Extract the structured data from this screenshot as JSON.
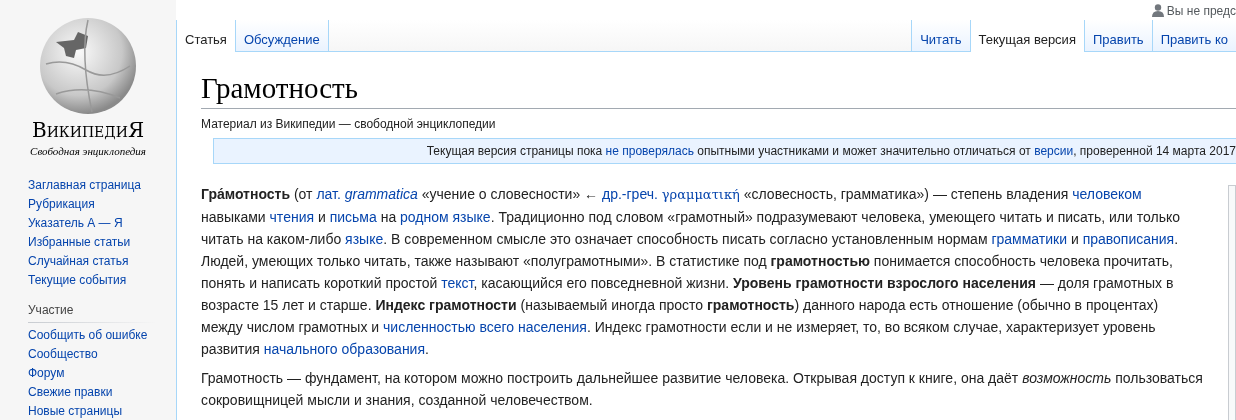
{
  "user_menu": {
    "label": "Вы не предс"
  },
  "logo": {
    "wordmark": "ВикипедиЯ",
    "tagline": "Свободная энциклопедия"
  },
  "sidebar": {
    "items": [
      {
        "label": "Заглавная страница"
      },
      {
        "label": "Рубрикация"
      },
      {
        "label": "Указатель А — Я"
      },
      {
        "label": "Избранные статьи"
      },
      {
        "label": "Случайная статья"
      },
      {
        "label": "Текущие события"
      }
    ],
    "sections": [
      {
        "heading": "Участие",
        "items": [
          {
            "label": "Сообщить об ошибке"
          },
          {
            "label": "Сообщество"
          },
          {
            "label": "Форум"
          },
          {
            "label": "Свежие правки"
          },
          {
            "label": "Новые страницы"
          }
        ]
      }
    ]
  },
  "namespace_tabs": [
    {
      "label": "Статья",
      "selected": true
    },
    {
      "label": "Обсуждение",
      "selected": false
    }
  ],
  "view_tabs": [
    {
      "label": "Читать",
      "selected": false
    },
    {
      "label": "Текущая версия",
      "selected": true
    },
    {
      "label": "Править",
      "selected": false
    },
    {
      "label": "Править ко",
      "selected": false
    }
  ],
  "article": {
    "title": "Грамотность",
    "subtitle": "Материал из Википедии — свободной энциклопедии",
    "notice": [
      {
        "kind": "text",
        "text": "Текущая версия страницы пока "
      },
      {
        "kind": "link",
        "text": "не проверялась"
      },
      {
        "kind": "text",
        "text": " опытными участниками и может значительно отличаться от "
      },
      {
        "kind": "link",
        "text": "версии"
      },
      {
        "kind": "text",
        "text": ", проверенной 14 марта 2017"
      }
    ],
    "paragraphs": [
      [
        {
          "kind": "bold",
          "text": "Гра́мотность"
        },
        {
          "kind": "text",
          "text": " (от "
        },
        {
          "kind": "link",
          "text": "лат.",
          "gap": true
        },
        {
          "kind": "link_italic",
          "text": "grammatica"
        },
        {
          "kind": "text",
          "text": " «учение о словесности» ← "
        },
        {
          "kind": "link",
          "text": "др.-греч.",
          "gap": true
        },
        {
          "kind": "link_serif",
          "text": "γραμματική"
        },
        {
          "kind": "text",
          "text": " «словесность, грамматика») — степень владения "
        },
        {
          "kind": "link",
          "text": "человеком"
        },
        {
          "kind": "text",
          "text": " навыками "
        },
        {
          "kind": "link",
          "text": "чтения"
        },
        {
          "kind": "text",
          "text": " и "
        },
        {
          "kind": "link",
          "text": "письма"
        },
        {
          "kind": "text",
          "text": " на "
        },
        {
          "kind": "link",
          "text": "родном языке"
        },
        {
          "kind": "text",
          "text": ". Традиционно под словом «грамотный» подразумевают человека, умеющего читать и писать, или только читать на каком-либо "
        },
        {
          "kind": "link",
          "text": "языке"
        },
        {
          "kind": "text",
          "text": ". В современном смысле это означает способность писать согласно установленным нормам "
        },
        {
          "kind": "link",
          "text": "грамматики"
        },
        {
          "kind": "text",
          "text": " и "
        },
        {
          "kind": "link",
          "text": "правописания"
        },
        {
          "kind": "text",
          "text": ". Людей, умеющих только читать, также называют «полуграмотными». В статистике под "
        },
        {
          "kind": "bold",
          "text": "грамотностью"
        },
        {
          "kind": "text",
          "text": " понимается способность человека прочитать, понять и написать короткий простой "
        },
        {
          "kind": "link",
          "text": "текст"
        },
        {
          "kind": "text",
          "text": ", касающийся его повседневной жизни. "
        },
        {
          "kind": "bold",
          "text": "Уровень грамотности взрослого населения"
        },
        {
          "kind": "text",
          "text": " — доля грамотных в возрасте 15 лет и старше. "
        },
        {
          "kind": "bold",
          "text": "Индекс грамотности"
        },
        {
          "kind": "text",
          "text": " (называемый иногда просто "
        },
        {
          "kind": "bold",
          "text": "грамотность"
        },
        {
          "kind": "text",
          "text": ") данного народа есть отношение (обычно в процентах) между числом грамотных и "
        },
        {
          "kind": "link",
          "text": "численностью всего населения"
        },
        {
          "kind": "text",
          "text": ". Индекс грамотности если и не измеряет, то, во всяком случае, характеризует уровень развития "
        },
        {
          "kind": "link",
          "text": "начального образования"
        },
        {
          "kind": "text",
          "text": "."
        }
      ],
      [
        {
          "kind": "text",
          "text": "Грамотность — фундамент, на котором можно построить дальнейшее развитие человека. Открывая доступ к книге, она даёт "
        },
        {
          "kind": "italic",
          "text": "возможность"
        },
        {
          "kind": "text",
          "text": " пользоваться сокровищницей мысли и знания, созданной человечеством."
        }
      ]
    ]
  }
}
